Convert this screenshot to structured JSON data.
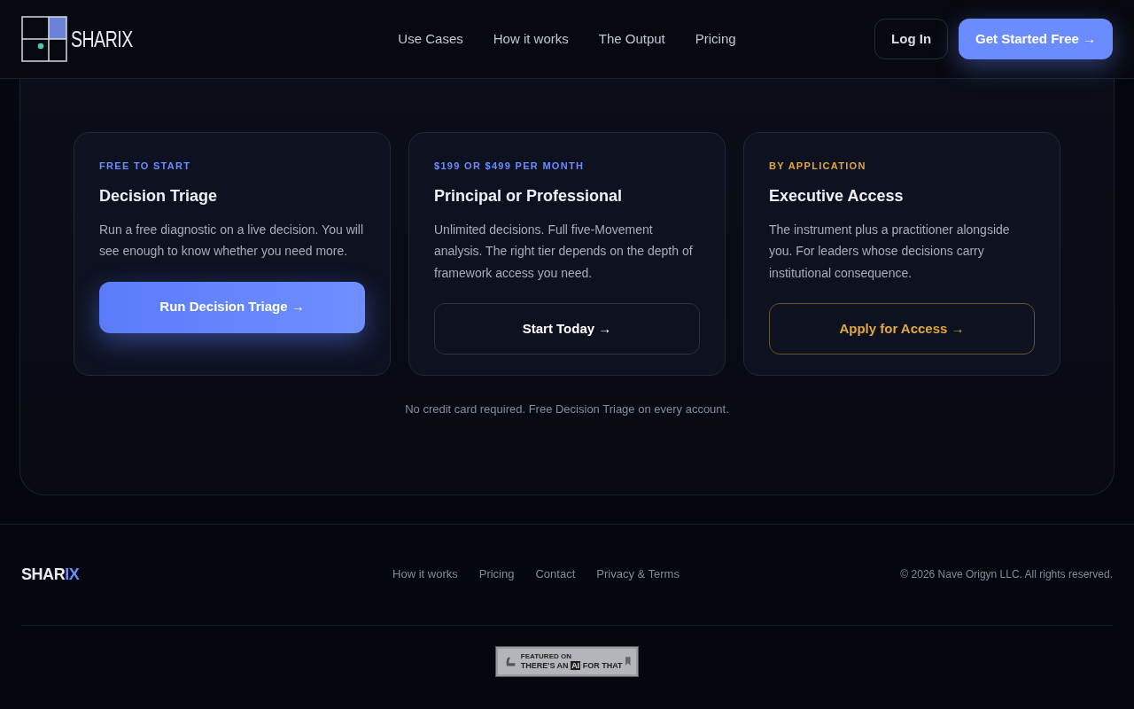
{
  "nav": {
    "brand": "SHARIX",
    "links": [
      "Use Cases",
      "How it works",
      "The Output",
      "Pricing"
    ],
    "login": "Log In",
    "cta": "Get Started Free",
    "cta_arrow": "→"
  },
  "plans": [
    {
      "kind": "primary",
      "tier": "FREE TO START",
      "title": "Decision Triage",
      "description": "Run a free diagnostic on a live decision. You will see enough to know whether you need more.",
      "button": "Run Decision Triage",
      "arrow": "→"
    },
    {
      "kind": "outline",
      "tier": "$199 OR $499 PER MONTH",
      "title": "Principal or Professional",
      "description": "Unlimited decisions. Full five-Movement analysis. The right tier depends on the depth of framework access you need.",
      "button": "Start Today",
      "arrow": "→"
    },
    {
      "kind": "gold",
      "tier": "BY APPLICATION",
      "title": "Executive Access",
      "description": "The instrument plus a practitioner alongside you. For leaders whose decisions carry institutional consequence.",
      "button": "Apply for Access",
      "arrow": "→"
    }
  ],
  "note": "No credit card required. Free Decision Triage on every account.",
  "footer": {
    "brand_main": "SHAR",
    "brand_accent": "IX",
    "links": [
      "How it works",
      "Pricing",
      "Contact",
      "Privacy & Terms"
    ],
    "copyright": "© 2026 Nave Origyn LLC. All rights reserved."
  },
  "badge": {
    "small": "FEATURED ON",
    "main_before": "THERE'S AN",
    "main_highlight": "AI",
    "main_after": "FOR THAT"
  }
}
